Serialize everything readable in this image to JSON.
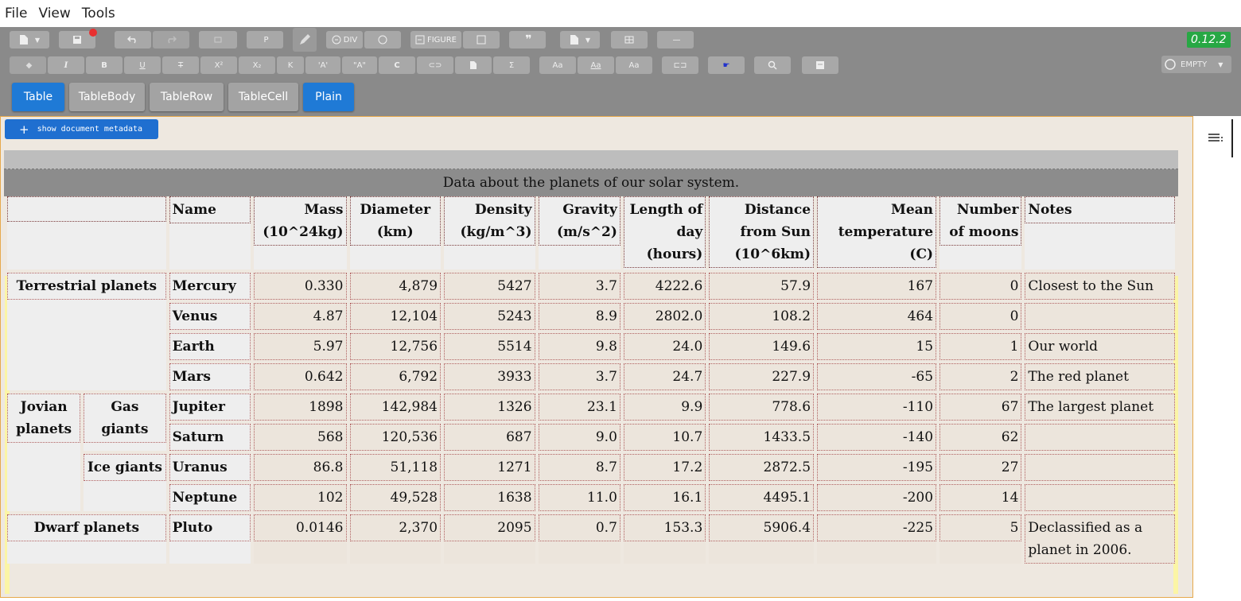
{
  "menu": [
    "File",
    "View",
    "Tools"
  ],
  "version": "0.12.2",
  "toolbar": {
    "div_label": "DIV",
    "figure_label": "FIGURE",
    "p_label": "P",
    "empty_label": "EMPTY"
  },
  "breadcrumbs": [
    {
      "label": "Table",
      "active": true
    },
    {
      "label": "TableBody",
      "active": false
    },
    {
      "label": "TableRow",
      "active": false
    },
    {
      "label": "TableCell",
      "active": false
    },
    {
      "label": "Plain",
      "active": true
    }
  ],
  "metadata_button": "show document metadata",
  "table": {
    "caption": "Data about the planets of our solar system.",
    "headers": [
      "",
      "Name",
      "Mass (10^24kg)",
      "Diameter (km)",
      "Density (kg/m^3)",
      "Gravity (m/s^2)",
      "Length of day (hours)",
      "Distance from Sun (10^6km)",
      "Mean temperature (C)",
      "Number of moons",
      "Notes"
    ],
    "groups": {
      "terrestrial": "Terrestrial planets",
      "jovian": "Jovian planets",
      "gas_giants": "Gas giants",
      "ice_giants": "Ice giants",
      "dwarf": "Dwarf planets"
    },
    "rows": [
      {
        "name": "Mercury",
        "mass": "0.330",
        "diameter": "4,879",
        "density": "5427",
        "gravity": "3.7",
        "day": "4222.6",
        "distance": "57.9",
        "temp": "167",
        "moons": "0",
        "notes": "Closest to the Sun"
      },
      {
        "name": "Venus",
        "mass": "4.87",
        "diameter": "12,104",
        "density": "5243",
        "gravity": "8.9",
        "day": "2802.0",
        "distance": "108.2",
        "temp": "464",
        "moons": "0",
        "notes": ""
      },
      {
        "name": "Earth",
        "mass": "5.97",
        "diameter": "12,756",
        "density": "5514",
        "gravity": "9.8",
        "day": "24.0",
        "distance": "149.6",
        "temp": "15",
        "moons": "1",
        "notes": "Our world"
      },
      {
        "name": "Mars",
        "mass": "0.642",
        "diameter": "6,792",
        "density": "3933",
        "gravity": "3.7",
        "day": "24.7",
        "distance": "227.9",
        "temp": "-65",
        "moons": "2",
        "notes": "The red planet"
      },
      {
        "name": "Jupiter",
        "mass": "1898",
        "diameter": "142,984",
        "density": "1326",
        "gravity": "23.1",
        "day": "9.9",
        "distance": "778.6",
        "temp": "-110",
        "moons": "67",
        "notes": "The largest planet"
      },
      {
        "name": "Saturn",
        "mass": "568",
        "diameter": "120,536",
        "density": "687",
        "gravity": "9.0",
        "day": "10.7",
        "distance": "1433.5",
        "temp": "-140",
        "moons": "62",
        "notes": ""
      },
      {
        "name": "Uranus",
        "mass": "86.8",
        "diameter": "51,118",
        "density": "1271",
        "gravity": "8.7",
        "day": "17.2",
        "distance": "2872.5",
        "temp": "-195",
        "moons": "27",
        "notes": ""
      },
      {
        "name": "Neptune",
        "mass": "102",
        "diameter": "49,528",
        "density": "1638",
        "gravity": "11.0",
        "day": "16.1",
        "distance": "4495.1",
        "temp": "-200",
        "moons": "14",
        "notes": ""
      },
      {
        "name": "Pluto",
        "mass": "0.0146",
        "diameter": "2,370",
        "density": "2095",
        "gravity": "0.7",
        "day": "153.3",
        "distance": "5906.4",
        "temp": "-225",
        "moons": "5",
        "notes": "Declassified as a planet in 2006."
      }
    ]
  },
  "colors": {
    "accent_blue": "#1f7ad6",
    "version_green": "#27a844",
    "toolbar_bg": "#8a8a8a",
    "doc_bg": "#eee8e0"
  }
}
